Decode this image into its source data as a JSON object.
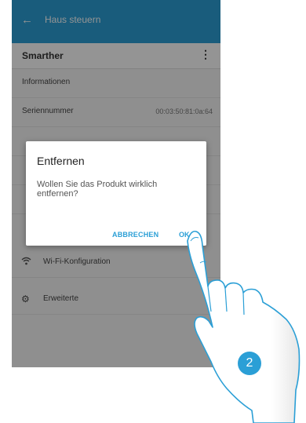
{
  "header": {
    "back_icon": "arrow-left-icon",
    "title": "Haus steuern"
  },
  "subheader": {
    "device_name": "Smarther",
    "menu_icon": "more-vert-icon"
  },
  "list": {
    "section_info": "Informationen",
    "serial_label": "Seriennummer",
    "serial_value": "00:03:50:81:0a:64",
    "wifi_label": "Wi-Fi-Konfiguration",
    "advanced_label": "Erweiterte"
  },
  "dialog": {
    "title": "Entfernen",
    "message": "Wollen Sie das Produkt wirklich entfernen?",
    "cancel_label": "ABBRECHEN",
    "ok_label": "OK"
  },
  "step_badge": "2",
  "colors": {
    "accent": "#2b9fd6",
    "scrim": "rgba(0,0,0,0.42)"
  }
}
